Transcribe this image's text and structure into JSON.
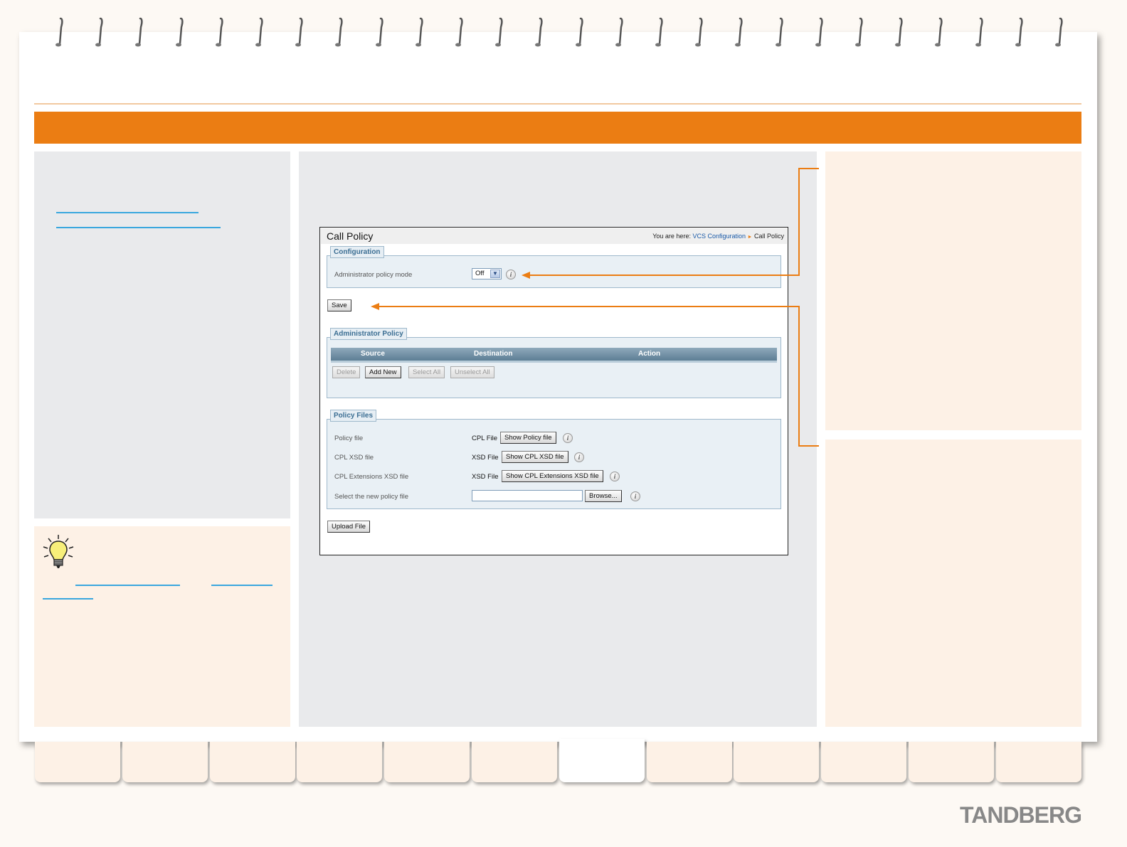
{
  "call_policy": {
    "title": "Call Policy",
    "breadcrumb": {
      "prefix": "You are here:",
      "link": "VCS Configuration",
      "current": "Call Policy"
    },
    "configuration": {
      "legend": "Configuration",
      "mode_label": "Administrator policy mode",
      "mode_value": "Off"
    },
    "save_label": "Save",
    "admin_policy": {
      "legend": "Administrator Policy",
      "columns": [
        "Source",
        "Destination",
        "Action"
      ],
      "buttons": {
        "delete": "Delete",
        "add_new": "Add New",
        "select_all": "Select All",
        "unselect_all": "Unselect All"
      }
    },
    "policy_files": {
      "legend": "Policy Files",
      "rows": [
        {
          "label": "Policy file",
          "type": "CPL File",
          "button": "Show Policy file"
        },
        {
          "label": "CPL XSD file",
          "type": "XSD File",
          "button": "Show CPL XSD file"
        },
        {
          "label": "CPL Extensions XSD file",
          "type": "XSD File",
          "button": "Show CPL Extensions XSD file"
        }
      ],
      "select_label": "Select the new policy file",
      "browse_label": "Browse..."
    },
    "upload_label": "Upload File"
  },
  "brand": {
    "logo": "TANDBERG",
    "accent": "#eb7d13",
    "link": "#39a7de"
  },
  "icons": [
    "lightbulb-icon",
    "info-icon",
    "chevron-down-icon"
  ]
}
